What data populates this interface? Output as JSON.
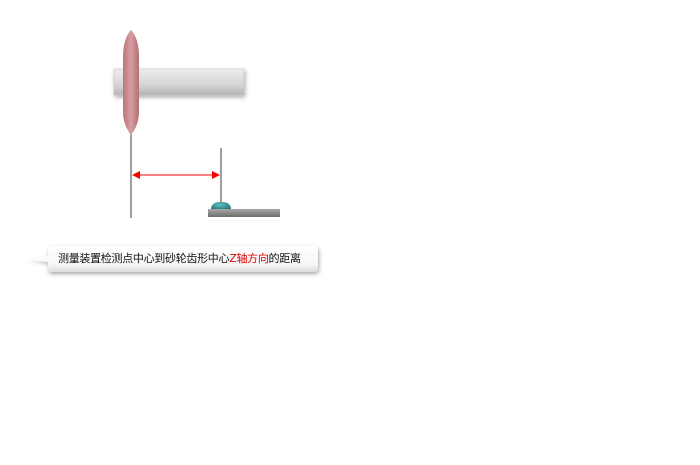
{
  "caption": {
    "part1": "测量装置检测点中心到砂轮齿形中心",
    "highlight": "Z轴方向",
    "part2": "的距离",
    "highlight_color": "#e00000"
  },
  "colors": {
    "probe": "#c98a8e",
    "arm": "#d4d4d4",
    "arrow": "#ff0000",
    "gear_tooth": "#2e8b8b",
    "base": "#8a8a8a"
  }
}
